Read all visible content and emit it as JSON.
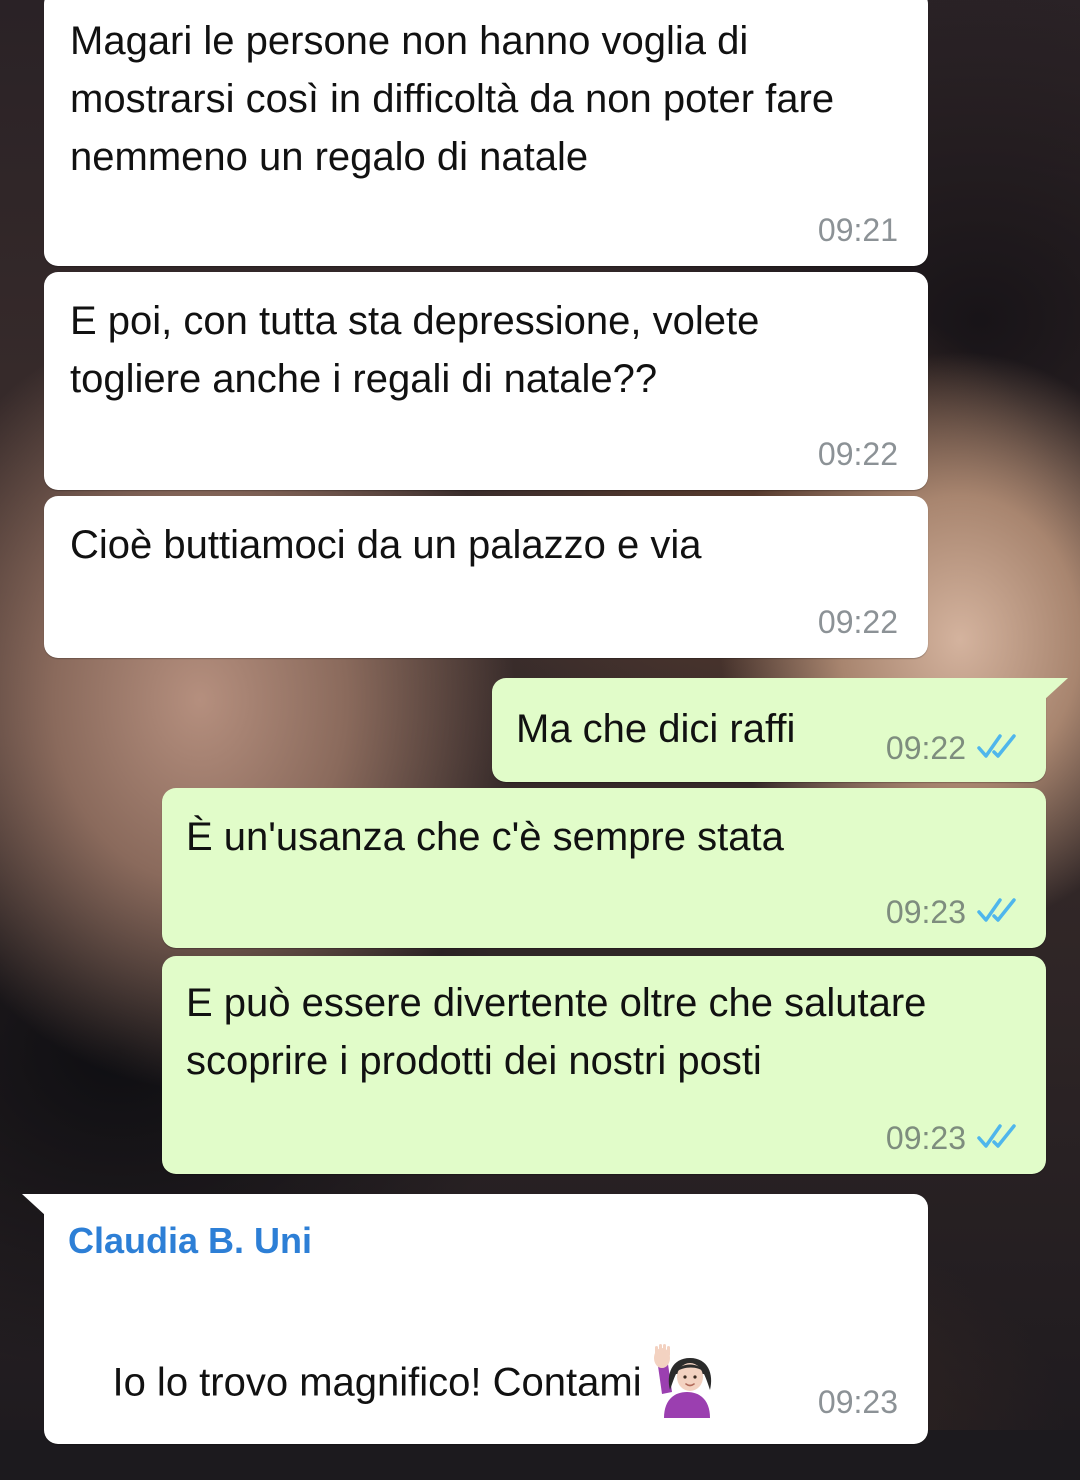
{
  "chat": {
    "messages": [
      {
        "direction": "in",
        "text": "Magari le persone non hanno voglia di mostrarsi così in difficoltà da non poter fare nemmeno un regalo di natale",
        "time": "09:21"
      },
      {
        "direction": "in",
        "text": "E poi, con tutta sta depressione, volete togliere anche i regali di natale??",
        "time": "09:22"
      },
      {
        "direction": "in",
        "text": "Cioè buttiamoci da un palazzo e via",
        "time": "09:22"
      },
      {
        "direction": "out",
        "text": "Ma che dici raffi",
        "time": "09:22",
        "status": "read"
      },
      {
        "direction": "out",
        "text": "È un'usanza che c'è sempre stata",
        "time": "09:23",
        "status": "read"
      },
      {
        "direction": "out",
        "text": "E può essere divertente oltre che salutare scoprire i prodotti dei nostri posti",
        "time": "09:23",
        "status": "read"
      },
      {
        "direction": "in",
        "sender": "Claudia B. Uni",
        "text": "Io lo trovo magnifico! Contami",
        "emoji": "woman-raising-hand-emoji",
        "time": "09:23"
      }
    ]
  },
  "colors": {
    "incoming_bubble": "#ffffff",
    "outgoing_bubble": "#e1fcc9",
    "sender_name": "#2d7fd6",
    "read_ticks": "#4fb6ec"
  }
}
